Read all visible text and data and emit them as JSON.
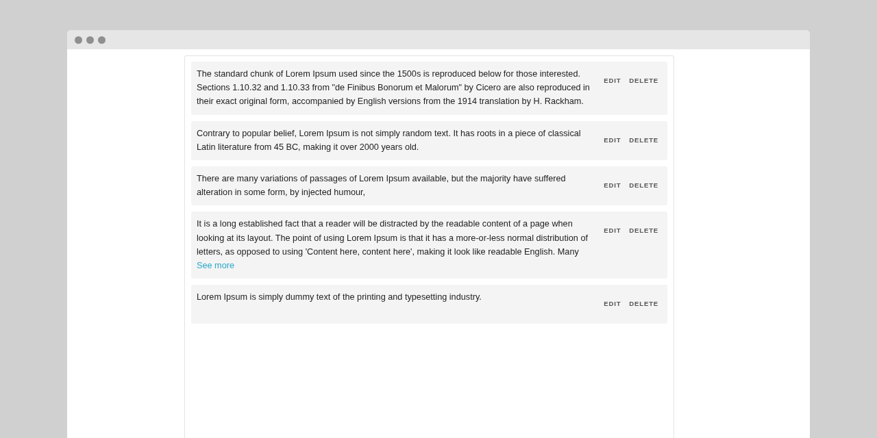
{
  "items": [
    {
      "text": "The standard chunk of Lorem Ipsum used since the 1500s is reproduced below for those interested. Sections 1.10.32 and 1.10.33 from \"de Finibus Bonorum et Malorum\" by Cicero are also reproduced in their exact original form, accompanied by English versions from the 1914 translation by H. Rackham.",
      "actions": [
        "EDIT",
        "DELETE"
      ]
    },
    {
      "text": "Contrary to popular belief, Lorem Ipsum is not simply random text. It has roots in a piece of classical Latin literature from 45 BC, making it over 2000 years old.",
      "actions": [
        "EDIT",
        "DELETE"
      ]
    },
    {
      "text": "There are many variations of passages of Lorem Ipsum available, but the majority have suffered alteration in some form, by injected humour,",
      "actions": [
        "EDIT",
        "DELETE"
      ]
    },
    {
      "text": "It is a long established fact that a reader will be distracted by the readable content of a page when looking at its layout. The point of using Lorem Ipsum is that it has a more-or-less normal distribution of letters, as opposed to using 'Content here, content here', making it look like readable English. Many",
      "link": "See more",
      "actions": [
        "EDIT",
        "DELETE"
      ]
    },
    {
      "text": "Lorem Ipsum is simply dummy text of the printing and typesetting industry.",
      "actions": [
        "EDIT",
        "DELETE"
      ]
    }
  ]
}
